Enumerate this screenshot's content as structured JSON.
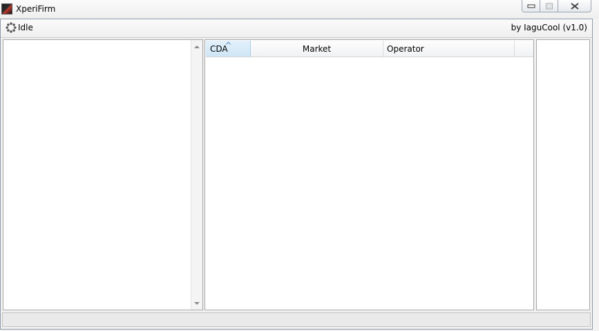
{
  "window": {
    "title": "XperiFirm"
  },
  "toolbar": {
    "status": "Idle",
    "credit": "by IaguCool (v1.0)"
  },
  "table": {
    "columns": [
      "CDA",
      "Market",
      "Operator"
    ],
    "sorted_column": "CDA",
    "sort_direction": "ascending",
    "rows": []
  }
}
